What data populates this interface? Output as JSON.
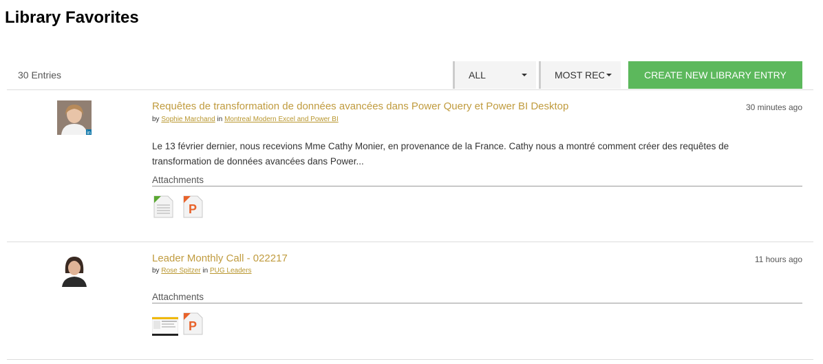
{
  "page": {
    "title": "Library Favorites"
  },
  "toolbar": {
    "entries_count": "30 Entries",
    "filter_selected": "ALL",
    "sort_selected": "MOST RECENT",
    "create_button": "CREATE NEW LIBRARY ENTRY"
  },
  "entries": [
    {
      "title": "Requêtes de transformation de données avancées dans Power Query et Power BI Desktop",
      "by_prefix": "by",
      "author": "Sophie Marchand",
      "in_word": "in",
      "community": "Montreal Modern Excel and Power BI",
      "time": "30 minutes ago",
      "excerpt": "Le 13 février dernier, nous recevions Mme Cathy Monier, en provenance de la France. Cathy nous a montré comment créer des requêtes de transformation de données avancées dans Power...",
      "attachments_label": "Attachments",
      "attachments": [
        "spreadsheet-file-icon",
        "powerpoint-file-icon"
      ]
    },
    {
      "title": "Leader Monthly Call - 022217",
      "by_prefix": "by",
      "author": "Rose Spitzer",
      "in_word": "in",
      "community": "PUG Leaders",
      "time": "11 hours ago",
      "attachments_label": "Attachments",
      "attachments": [
        "screenshot-file-icon",
        "powerpoint-file-icon"
      ]
    }
  ],
  "colors": {
    "accent_green": "#5cb85c",
    "link_gold": "#c09b3e"
  }
}
